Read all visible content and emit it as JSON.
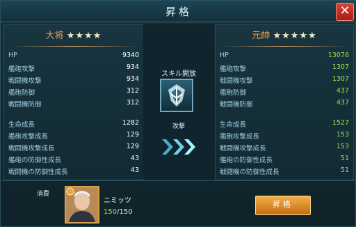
{
  "title": "昇格",
  "close_label": "✕",
  "left": {
    "rank": "大将",
    "stars": "★★★★",
    "stats": [
      {
        "label": "HP",
        "value": "9340"
      },
      {
        "label": "艦砲攻撃",
        "value": "934"
      },
      {
        "label": "戦闘機攻撃",
        "value": "934"
      },
      {
        "label": "艦砲防御",
        "value": "312"
      },
      {
        "label": "戦闘機防御",
        "value": "312"
      }
    ],
    "growth": [
      {
        "label": "生命成長",
        "value": "1282"
      },
      {
        "label": "艦砲攻撃成長",
        "value": "129"
      },
      {
        "label": "戦闘機攻撃成長",
        "value": "129"
      },
      {
        "label": "艦砲の防御性成長",
        "value": "43"
      },
      {
        "label": "戦闘機の防御性成長",
        "value": "43"
      }
    ]
  },
  "right": {
    "rank": "元帥",
    "stars": "★★★★★",
    "stats": [
      {
        "label": "HP",
        "value": "13076"
      },
      {
        "label": "艦砲攻撃",
        "value": "1307"
      },
      {
        "label": "戦闘機攻撃",
        "value": "1307"
      },
      {
        "label": "艦砲防御",
        "value": "437"
      },
      {
        "label": "戦闘機防御",
        "value": "437"
      }
    ],
    "growth": [
      {
        "label": "生命成長",
        "value": "1527"
      },
      {
        "label": "艦砲攻撃成長",
        "value": "153"
      },
      {
        "label": "戦闘機攻撃成長",
        "value": "153"
      },
      {
        "label": "艦砲の防御性成長",
        "value": "51"
      },
      {
        "label": "戦闘機の防御性成長",
        "value": "51"
      }
    ]
  },
  "skill": {
    "unlock_label": "スキル開放",
    "name": "攻撃",
    "icon": "skill-attack-icon"
  },
  "cost": {
    "label": "消費",
    "name": "ニミッツ",
    "current": "150",
    "required": "/150"
  },
  "upgrade_button": "昇格",
  "colors": {
    "accent_orange": "#e9a86a",
    "gain_green": "#9be14a",
    "stat_label": "#9fcde0"
  }
}
